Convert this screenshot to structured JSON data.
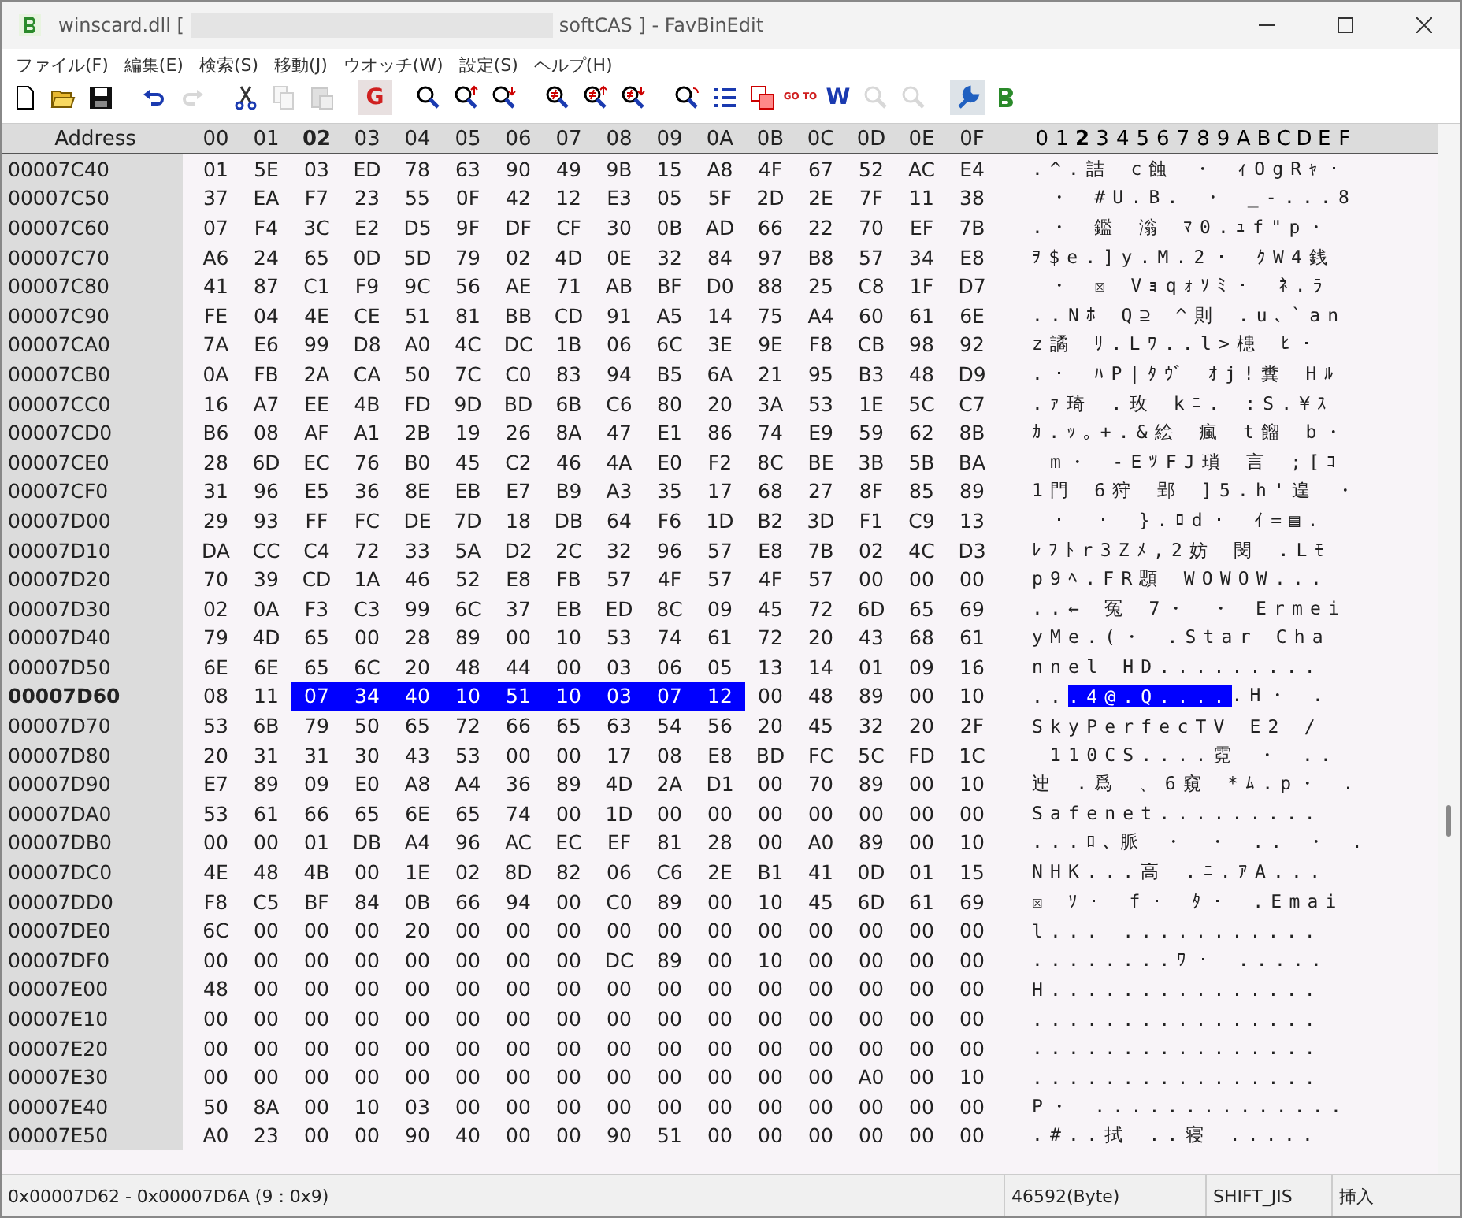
{
  "window": {
    "title_start": "winscard.dll [",
    "title_end": "softCAS ] - FavBinEdit"
  },
  "menu": [
    "ファイル(F)",
    "編集(E)",
    "検索(S)",
    "移動(J)",
    "ウオッチ(W)",
    "設定(S)",
    "ヘルプ(H)"
  ],
  "toolbar": [
    [
      {
        "kind": "new",
        "disabled": false
      },
      {
        "kind": "open",
        "disabled": false
      },
      {
        "kind": "save",
        "disabled": false
      }
    ],
    [
      {
        "kind": "undo",
        "disabled": false
      },
      {
        "kind": "redo",
        "disabled": true
      }
    ],
    [
      {
        "kind": "cut",
        "disabled": false
      },
      {
        "kind": "copy",
        "disabled": true
      },
      {
        "kind": "paste",
        "disabled": true
      }
    ],
    [
      {
        "kind": "glyph",
        "glyph": "G",
        "disabled": false
      }
    ],
    [
      {
        "kind": "search",
        "disabled": false
      },
      {
        "kind": "search-up",
        "disabled": false
      },
      {
        "kind": "search-down",
        "disabled": false
      }
    ],
    [
      {
        "kind": "diff",
        "disabled": false
      },
      {
        "kind": "diff-up",
        "disabled": false
      },
      {
        "kind": "diff-down",
        "disabled": false
      }
    ],
    [
      {
        "kind": "replace",
        "disabled": false
      },
      {
        "kind": "list",
        "disabled": false
      },
      {
        "kind": "compare",
        "disabled": false
      },
      {
        "kind": "glyph",
        "glyph": "GO TO",
        "disabled": false
      },
      {
        "kind": "glyph",
        "glyph": "W",
        "disabled": false
      },
      {
        "kind": "watch",
        "disabled": true
      },
      {
        "kind": "watch",
        "disabled": true
      }
    ],
    [
      {
        "kind": "settings",
        "disabled": false
      },
      {
        "kind": "app",
        "disabled": false
      }
    ]
  ],
  "header": {
    "address": "Address",
    "columns": [
      {
        "label": "00",
        "current": false
      },
      {
        "label": "01",
        "current": false
      },
      {
        "label": "02",
        "current": true
      },
      {
        "label": "03",
        "current": false
      },
      {
        "label": "04",
        "current": false
      },
      {
        "label": "05",
        "current": false
      },
      {
        "label": "06",
        "current": false
      },
      {
        "label": "07",
        "current": false
      },
      {
        "label": "08",
        "current": false
      },
      {
        "label": "09",
        "current": false
      },
      {
        "label": "0A",
        "current": false
      },
      {
        "label": "0B",
        "current": false
      },
      {
        "label": "0C",
        "current": false
      },
      {
        "label": "0D",
        "current": false
      },
      {
        "label": "0E",
        "current": false
      },
      {
        "label": "0F",
        "current": false
      }
    ],
    "text_columns": [
      {
        "label": "0",
        "current": false
      },
      {
        "label": "1",
        "current": false
      },
      {
        "label": "2",
        "current": true
      },
      {
        "label": "3",
        "current": false
      },
      {
        "label": "4",
        "current": false
      },
      {
        "label": "5",
        "current": false
      },
      {
        "label": "6",
        "current": false
      },
      {
        "label": "7",
        "current": false
      },
      {
        "label": "8",
        "current": false
      },
      {
        "label": "9",
        "current": false
      },
      {
        "label": "A",
        "current": false
      },
      {
        "label": "B",
        "current": false
      },
      {
        "label": "C",
        "current": false
      },
      {
        "label": "D",
        "current": false
      },
      {
        "label": "E",
        "current": false
      },
      {
        "label": "F",
        "current": false
      }
    ]
  },
  "rows": [
    {
      "address": "00007C40",
      "current": false,
      "bytes": [
        "01",
        "5E",
        "03",
        "ED",
        "78",
        "63",
        "90",
        "49",
        "9B",
        "15",
        "A8",
        "4F",
        "67",
        "52",
        "AC",
        "E4"
      ],
      "text": ".^.詰 c蝕 ・ ｨOgRｬ・"
    },
    {
      "address": "00007C50",
      "current": false,
      "bytes": [
        "37",
        "EA",
        "F7",
        "23",
        "55",
        "0F",
        "42",
        "12",
        "E3",
        "05",
        "5F",
        "2D",
        "2E",
        "7F",
        "11",
        "38"
      ],
      "text": " ・ #U.B. ・ _-...8"
    },
    {
      "address": "00007C60",
      "current": false,
      "bytes": [
        "07",
        "F4",
        "3C",
        "E2",
        "D5",
        "9F",
        "DF",
        "CF",
        "30",
        "0B",
        "AD",
        "66",
        "22",
        "70",
        "EF",
        "7B"
      ],
      "text": ".・ 鑑 滃 ﾏ0.ｭf\"p・"
    },
    {
      "address": "00007C70",
      "current": false,
      "bytes": [
        "A6",
        "24",
        "65",
        "0D",
        "5D",
        "79",
        "02",
        "4D",
        "0E",
        "32",
        "84",
        "97",
        "B8",
        "57",
        "34",
        "E8"
      ],
      "text": "ｦ$e.]y.M.2・ ｸW4銭"
    },
    {
      "address": "00007C80",
      "current": false,
      "bytes": [
        "41",
        "87",
        "C1",
        "F9",
        "9C",
        "56",
        "AE",
        "71",
        "AB",
        "BF",
        "D0",
        "88",
        "25",
        "C8",
        "1F",
        "D7"
      ],
      "text": " ・ ☒ Vｮqｫｿﾐ・ ﾈ.ﾗ"
    },
    {
      "address": "00007C90",
      "current": false,
      "bytes": [
        "FE",
        "04",
        "4E",
        "CE",
        "51",
        "81",
        "BB",
        "CD",
        "91",
        "A5",
        "14",
        "75",
        "A4",
        "60",
        "61",
        "6E"
      ],
      "text": "..Nﾎ Q⊇ ^則 .u､`an"
    },
    {
      "address": "00007CA0",
      "current": false,
      "bytes": [
        "7A",
        "E6",
        "99",
        "D8",
        "A0",
        "4C",
        "DC",
        "1B",
        "06",
        "6C",
        "3E",
        "9E",
        "F8",
        "CB",
        "98",
        "92"
      ],
      "text": "z譎 ﾘ.Lﾜ..l>槵 ﾋ・"
    },
    {
      "address": "00007CB0",
      "current": false,
      "bytes": [
        "0A",
        "FB",
        "2A",
        "CA",
        "50",
        "7C",
        "C0",
        "83",
        "94",
        "B5",
        "6A",
        "21",
        "95",
        "B3",
        "48",
        "D9"
      ],
      "text": ".・ ﾊP|ﾀｳﾞ ｵj!糞 Hﾙ"
    },
    {
      "address": "00007CC0",
      "current": false,
      "bytes": [
        "16",
        "A7",
        "EE",
        "4B",
        "FD",
        "9D",
        "BD",
        "6B",
        "C6",
        "80",
        "20",
        "3A",
        "53",
        "1E",
        "5C",
        "C7"
      ],
      "text": ".ｧ琦 .玫 kﾆ. :S.¥ｽ"
    },
    {
      "address": "00007CD0",
      "current": false,
      "bytes": [
        "B6",
        "08",
        "AF",
        "A1",
        "2B",
        "19",
        "26",
        "8A",
        "47",
        "E1",
        "86",
        "74",
        "E9",
        "59",
        "62",
        "8B"
      ],
      "text": "ｶ.ｯ｡+.&絵 瘋 t餾 b・"
    },
    {
      "address": "00007CE0",
      "current": false,
      "bytes": [
        "28",
        "6D",
        "EC",
        "76",
        "B0",
        "45",
        "C2",
        "46",
        "4A",
        "E0",
        "F2",
        "8C",
        "BE",
        "3B",
        "5B",
        "BA"
      ],
      "text": " m・ -EﾂFJ瑣 言 ;[ｺ"
    },
    {
      "address": "00007CF0",
      "current": false,
      "bytes": [
        "31",
        "96",
        "E5",
        "36",
        "8E",
        "EB",
        "E7",
        "B9",
        "A3",
        "35",
        "17",
        "68",
        "27",
        "8F",
        "85",
        "89"
      ],
      "text": "1門 6狩 郢 ]5.h'遑 ・"
    },
    {
      "address": "00007D00",
      "current": false,
      "bytes": [
        "29",
        "93",
        "FF",
        "FC",
        "DE",
        "7D",
        "18",
        "DB",
        "64",
        "F6",
        "1D",
        "B2",
        "3D",
        "F1",
        "C9",
        "13"
      ],
      "text": " ・ ・ }.ﾛd・ ｲ=▤."
    },
    {
      "address": "00007D10",
      "current": false,
      "bytes": [
        "DA",
        "CC",
        "C4",
        "72",
        "33",
        "5A",
        "D2",
        "2C",
        "32",
        "96",
        "57",
        "E8",
        "7B",
        "02",
        "4C",
        "D3"
      ],
      "text": "ﾚﾌﾄr3Zﾒ,2妨 閔 .Lﾓ"
    },
    {
      "address": "00007D20",
      "current": false,
      "bytes": [
        "70",
        "39",
        "CD",
        "1A",
        "46",
        "52",
        "E8",
        "FB",
        "57",
        "4F",
        "57",
        "4F",
        "57",
        "00",
        "00",
        "00"
      ],
      "text": "p9ﾍ.FR顋 WOWOW..."
    },
    {
      "address": "00007D30",
      "current": false,
      "bytes": [
        "02",
        "0A",
        "F3",
        "C3",
        "99",
        "6C",
        "37",
        "EB",
        "ED",
        "8C",
        "09",
        "45",
        "72",
        "6D",
        "65",
        "69"
      ],
      "text": "..← 冤 7・ ・ Ermei"
    },
    {
      "address": "00007D40",
      "current": false,
      "bytes": [
        "79",
        "4D",
        "65",
        "00",
        "28",
        "89",
        "00",
        "10",
        "53",
        "74",
        "61",
        "72",
        "20",
        "43",
        "68",
        "61"
      ],
      "text": "yMe.(・ .Star Cha"
    },
    {
      "address": "00007D50",
      "current": false,
      "bytes": [
        "6E",
        "6E",
        "65",
        "6C",
        "20",
        "48",
        "44",
        "00",
        "03",
        "06",
        "05",
        "13",
        "14",
        "01",
        "09",
        "16"
      ],
      "text": "nnel HD........."
    },
    {
      "address": "00007D60",
      "current": true,
      "bytes": [
        "08",
        "11"
      ],
      "selected_bytes": [
        "07",
        "34",
        "40",
        "10",
        "51",
        "10",
        "03",
        "07",
        "12"
      ],
      "bytes_after": [
        "00",
        "48",
        "89",
        "00",
        "10"
      ],
      "text": "..",
      "selected_text": ".4@.Q....",
      "text_after": ".H・ ."
    },
    {
      "address": "00007D70",
      "current": false,
      "bytes": [
        "53",
        "6B",
        "79",
        "50",
        "65",
        "72",
        "66",
        "65",
        "63",
        "54",
        "56",
        "20",
        "45",
        "32",
        "20",
        "2F"
      ],
      "text": "SkyPerfecTV E2 /"
    },
    {
      "address": "00007D80",
      "current": false,
      "bytes": [
        "20",
        "31",
        "31",
        "30",
        "43",
        "53",
        "00",
        "00",
        "17",
        "08",
        "E8",
        "BD",
        "FC",
        "5C",
        "FD",
        "1C"
      ],
      "text": " 110CS....霓 ・ .."
    },
    {
      "address": "00007D90",
      "current": false,
      "bytes": [
        "E7",
        "89",
        "09",
        "E0",
        "A8",
        "A4",
        "36",
        "89",
        "4D",
        "2A",
        "D1",
        "00",
        "70",
        "89",
        "00",
        "10"
      ],
      "text": "迚 .爲 、6窺 *ﾑ.p・ ."
    },
    {
      "address": "00007DA0",
      "current": false,
      "bytes": [
        "53",
        "61",
        "66",
        "65",
        "6E",
        "65",
        "74",
        "00",
        "1D",
        "00",
        "00",
        "00",
        "00",
        "00",
        "00",
        "00"
      ],
      "text": "Safenet........."
    },
    {
      "address": "00007DB0",
      "current": false,
      "bytes": [
        "00",
        "00",
        "01",
        "DB",
        "A4",
        "96",
        "AC",
        "EC",
        "EF",
        "81",
        "28",
        "00",
        "A0",
        "89",
        "00",
        "10"
      ],
      "text": "...ﾛ､脈 ・ ・ .. ・ ."
    },
    {
      "address": "00007DC0",
      "current": false,
      "bytes": [
        "4E",
        "48",
        "4B",
        "00",
        "1E",
        "02",
        "8D",
        "82",
        "06",
        "C6",
        "2E",
        "B1",
        "41",
        "0D",
        "01",
        "15"
      ],
      "text": "NHK...高 .ﾆ.ｱA..."
    },
    {
      "address": "00007DD0",
      "current": false,
      "bytes": [
        "F8",
        "C5",
        "BF",
        "84",
        "0B",
        "66",
        "94",
        "00",
        "C0",
        "89",
        "00",
        "10",
        "45",
        "6D",
        "61",
        "69"
      ],
      "text": "☒ ｿ・ f・ ﾀ・ .Emai"
    },
    {
      "address": "00007DE0",
      "current": false,
      "bytes": [
        "6C",
        "00",
        "00",
        "00",
        "20",
        "00",
        "00",
        "00",
        "00",
        "00",
        "00",
        "00",
        "00",
        "00",
        "00",
        "00"
      ],
      "text": "l... ..........."
    },
    {
      "address": "00007DF0",
      "current": false,
      "bytes": [
        "00",
        "00",
        "00",
        "00",
        "00",
        "00",
        "00",
        "00",
        "DC",
        "89",
        "00",
        "10",
        "00",
        "00",
        "00",
        "00"
      ],
      "text": "........ﾜ・ ....."
    },
    {
      "address": "00007E00",
      "current": false,
      "bytes": [
        "48",
        "00",
        "00",
        "00",
        "00",
        "00",
        "00",
        "00",
        "00",
        "00",
        "00",
        "00",
        "00",
        "00",
        "00",
        "00"
      ],
      "text": "H..............."
    },
    {
      "address": "00007E10",
      "current": false,
      "bytes": [
        "00",
        "00",
        "00",
        "00",
        "00",
        "00",
        "00",
        "00",
        "00",
        "00",
        "00",
        "00",
        "00",
        "00",
        "00",
        "00"
      ],
      "text": "................"
    },
    {
      "address": "00007E20",
      "current": false,
      "bytes": [
        "00",
        "00",
        "00",
        "00",
        "00",
        "00",
        "00",
        "00",
        "00",
        "00",
        "00",
        "00",
        "00",
        "00",
        "00",
        "00"
      ],
      "text": "................"
    },
    {
      "address": "00007E30",
      "current": false,
      "bytes": [
        "00",
        "00",
        "00",
        "00",
        "00",
        "00",
        "00",
        "00",
        "00",
        "00",
        "00",
        "00",
        "00",
        "A0",
        "00",
        "10"
      ],
      "text": "................"
    },
    {
      "address": "00007E40",
      "current": false,
      "bytes": [
        "50",
        "8A",
        "00",
        "10",
        "03",
        "00",
        "00",
        "00",
        "00",
        "00",
        "00",
        "00",
        "00",
        "00",
        "00",
        "00"
      ],
      "text": "P・ .............."
    },
    {
      "address": "00007E50",
      "current": false,
      "bytes": [
        "A0",
        "23",
        "00",
        "00",
        "90",
        "40",
        "00",
        "00",
        "90",
        "51",
        "00",
        "00",
        "00",
        "00",
        "00",
        "00"
      ],
      "text": ".#..拭 ..寝 ....."
    }
  ],
  "status_bar": {
    "selection": "0x00007D62 - 0x00007D6A (9 : 0x9)",
    "size": "46592(Byte)",
    "encoding": "SHIFT_JIS",
    "mode": "挿入"
  }
}
